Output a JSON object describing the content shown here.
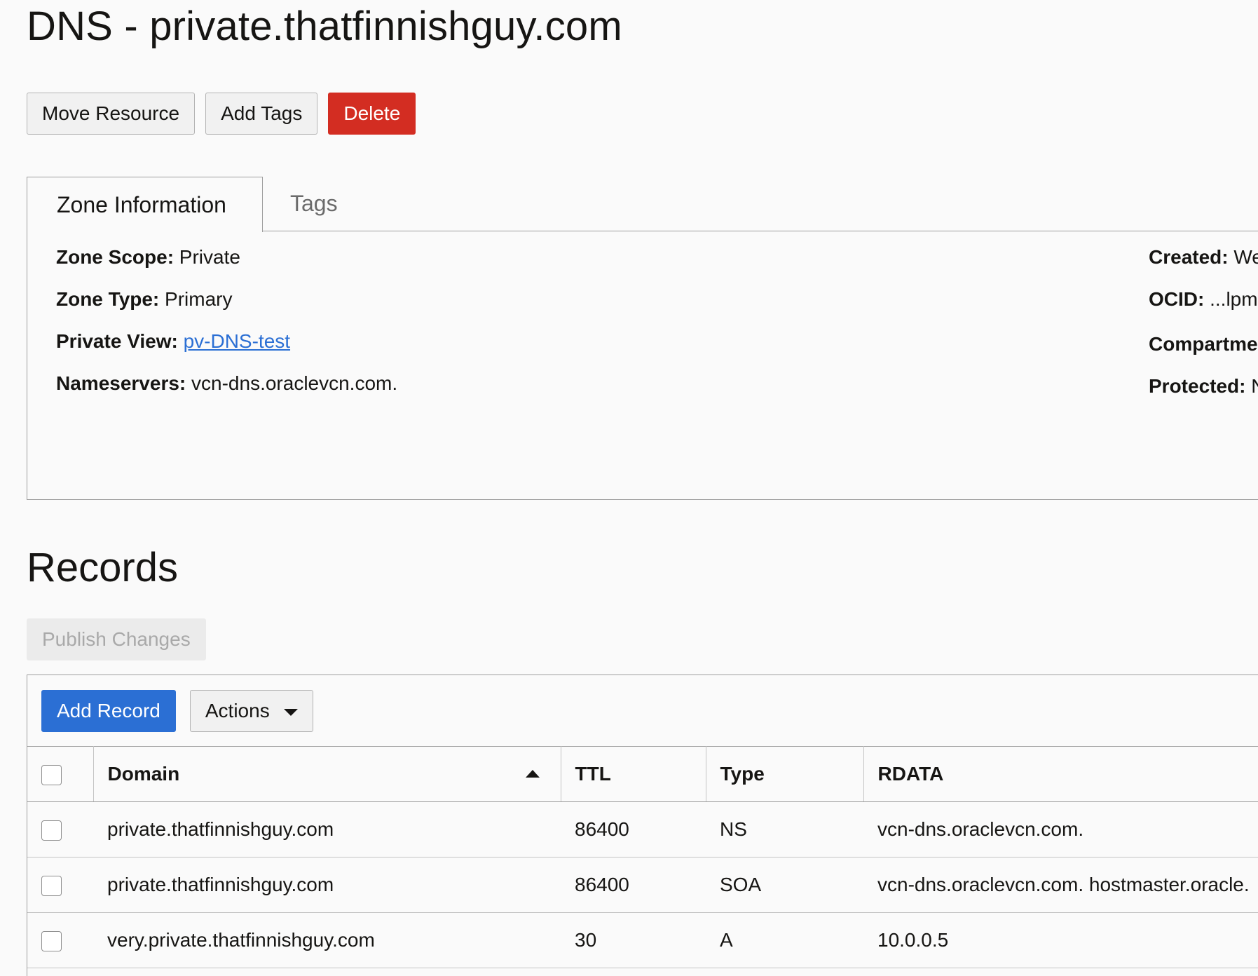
{
  "page_title": "DNS - private.thatfinnishguy.com",
  "toolbar": {
    "move_resource": "Move Resource",
    "add_tags": "Add Tags",
    "delete": "Delete"
  },
  "tabs": [
    {
      "label": "Zone Information",
      "active": true
    },
    {
      "label": "Tags",
      "active": false
    }
  ],
  "zone_info": {
    "scope_label": "Zone Scope:",
    "scope_value": "Private",
    "type_label": "Zone Type:",
    "type_value": "Primary",
    "private_view_label": "Private View:",
    "private_view_value": "pv-DNS-test",
    "nameservers_label": "Nameservers:",
    "nameservers_value": "vcn-dns.oraclevcn.com.",
    "created_label": "Created:",
    "created_value": "We",
    "ocid_label": "OCID:",
    "ocid_value": "...lpm",
    "compartment_label": "Compartme",
    "protected_label": "Protected:",
    "protected_value": "N"
  },
  "records": {
    "title": "Records",
    "publish_changes": "Publish Changes",
    "add_record": "Add Record",
    "actions": "Actions",
    "columns": [
      "Domain",
      "TTL",
      "Type",
      "RDATA"
    ],
    "rows": [
      {
        "domain": "private.thatfinnishguy.com",
        "ttl": "86400",
        "type": "NS",
        "rdata": "vcn-dns.oraclevcn.com."
      },
      {
        "domain": "private.thatfinnishguy.com",
        "ttl": "86400",
        "type": "SOA",
        "rdata": "vcn-dns.oraclevcn.com. hostmaster.oracle."
      },
      {
        "domain": "very.private.thatfinnishguy.com",
        "ttl": "30",
        "type": "A",
        "rdata": "10.0.0.5"
      }
    ]
  },
  "colors": {
    "danger": "#d32d22",
    "primary": "#2b6fd4",
    "link": "#2b6fd4"
  }
}
